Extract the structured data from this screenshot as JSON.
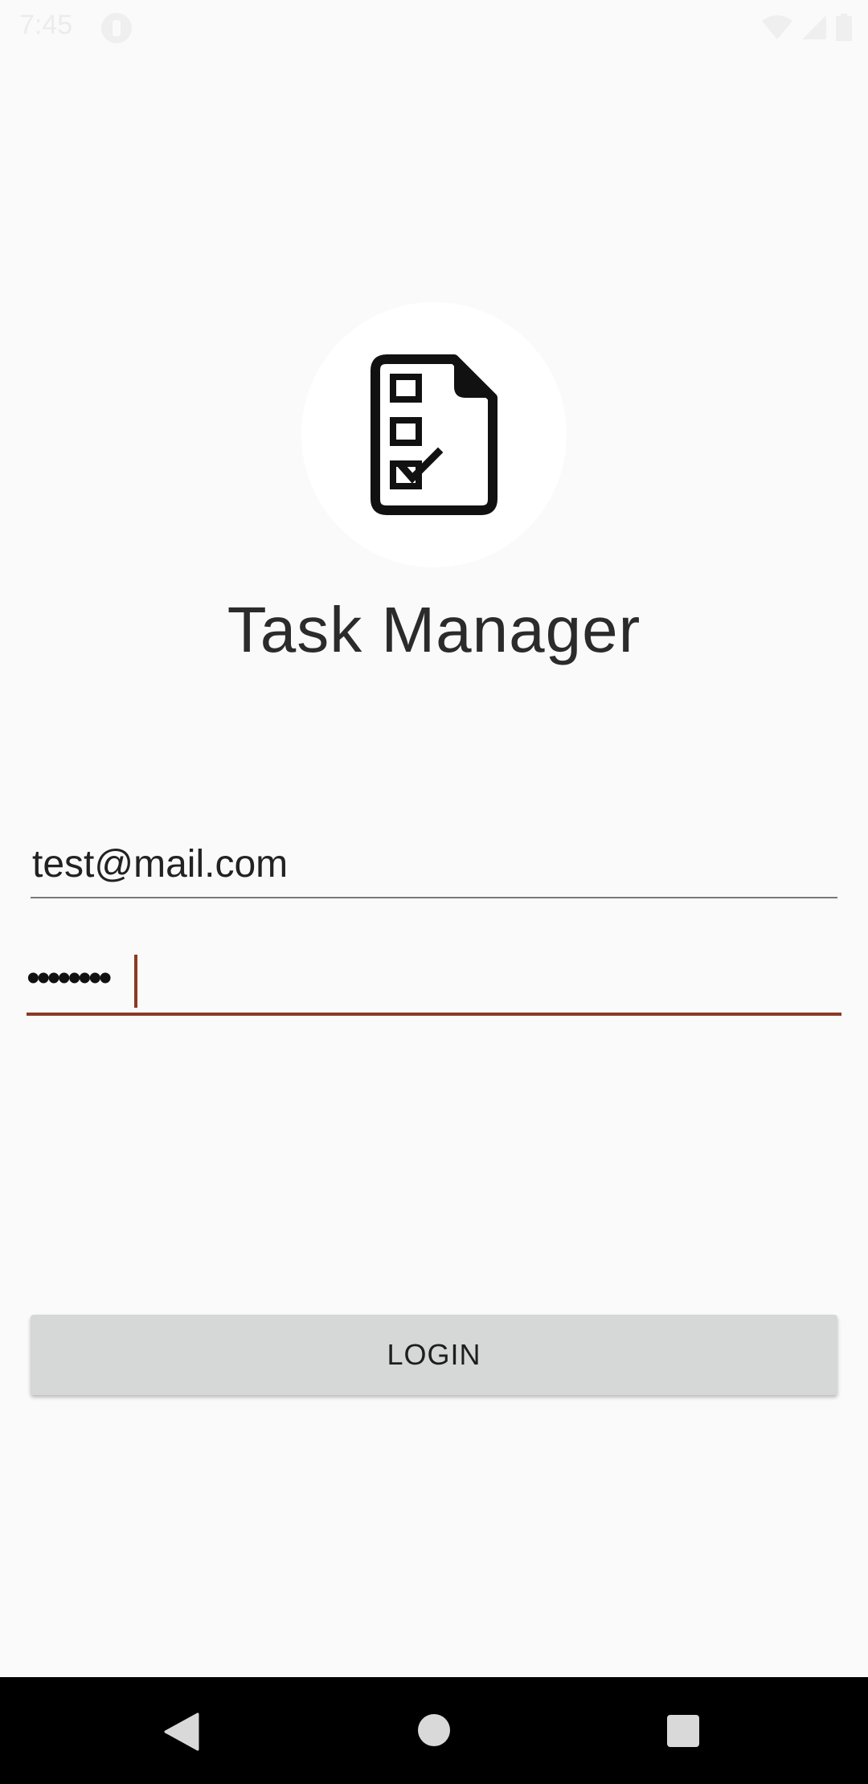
{
  "status_bar": {
    "time": "7:45",
    "icons": [
      "notification-icon",
      "wifi-icon",
      "signal-icon",
      "battery-icon"
    ]
  },
  "app": {
    "logo_icon": "checklist-document-icon",
    "title": "Task Manager"
  },
  "form": {
    "email_value": "test@mail.com",
    "password_value": "••••••••",
    "login_label": "LOGIN"
  },
  "colors": {
    "background": "#fafafa",
    "accent": "#8b3a24",
    "button": "#d6d7d7",
    "nav_bar": "#000000"
  },
  "nav_bar": {
    "icons": [
      "back-icon",
      "home-icon",
      "recents-icon"
    ]
  }
}
